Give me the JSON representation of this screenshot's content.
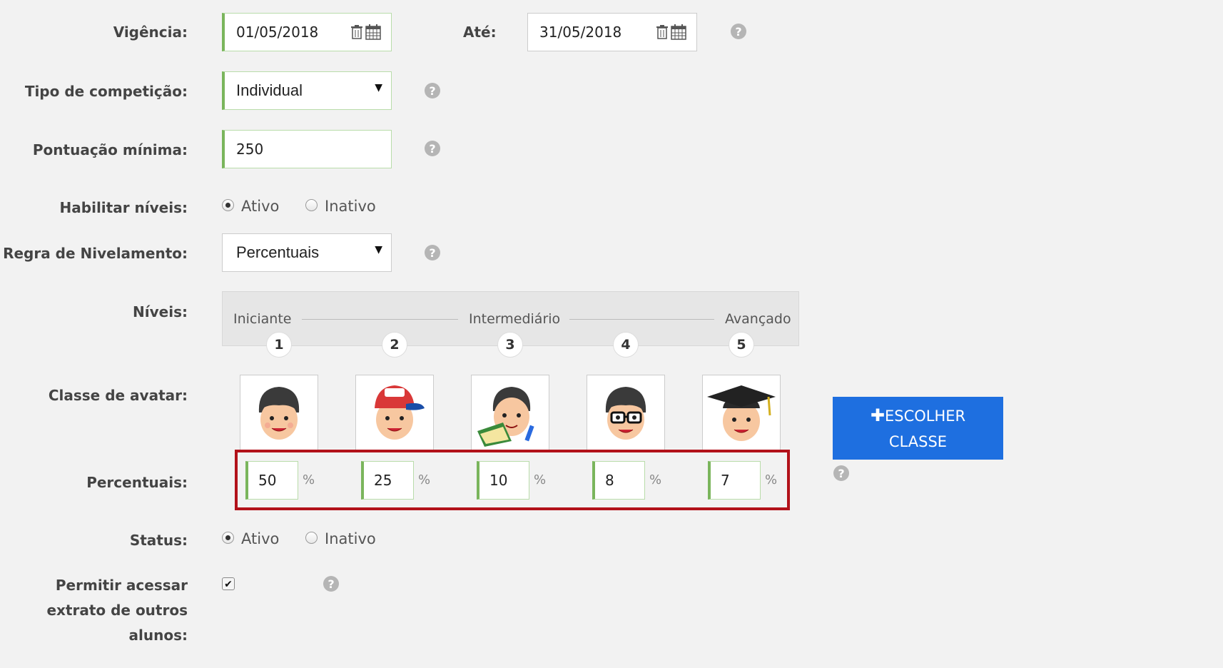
{
  "labels": {
    "vigencia": "Vigência:",
    "ate": "Até:",
    "tipo": "Tipo de competição:",
    "pontuacao": "Pontuação mínima:",
    "habilitar": "Habilitar níveis:",
    "regra": "Regra de Nivelamento:",
    "niveis": "Níveis:",
    "classe": "Classe de avatar:",
    "percentuais": "Percentuais:",
    "status": "Status:",
    "permitir_1": "Permitir acessar",
    "permitir_2": "extrato de outros",
    "permitir_3": "alunos:"
  },
  "vigencia": {
    "from": "01/05/2018",
    "to": "31/05/2018"
  },
  "tipo_competicao": {
    "selected": "Individual"
  },
  "pontuacao_minima": "250",
  "habilitar_niveis": {
    "options": [
      "Ativo",
      "Inativo"
    ],
    "selected": "Ativo"
  },
  "regra_nivelamento": {
    "selected": "Percentuais"
  },
  "niveis": {
    "stages": [
      "Iniciante",
      "Intermediário",
      "Avançado"
    ],
    "numbers": [
      "1",
      "2",
      "3",
      "4",
      "5"
    ]
  },
  "avatars": [
    "plain-boy-avatar",
    "cap-boy-avatar",
    "book-boy-avatar",
    "glasses-boy-avatar",
    "graduate-boy-avatar"
  ],
  "percentuais": {
    "values": [
      "50",
      "25",
      "10",
      "8",
      "7"
    ],
    "unit": "%"
  },
  "choose_button": {
    "line1": "ESCOLHER",
    "line2": "CLASSE",
    "icon": "plus-icon"
  },
  "status": {
    "options": [
      "Ativo",
      "Inativo"
    ],
    "selected": "Ativo"
  },
  "permitir_acessar": {
    "checked": true,
    "mark": "✔"
  },
  "help_glyph": "?",
  "colors": {
    "accent_green": "#7ab55c",
    "button_blue": "#1e6fe0",
    "highlight_red": "#b2121a"
  }
}
